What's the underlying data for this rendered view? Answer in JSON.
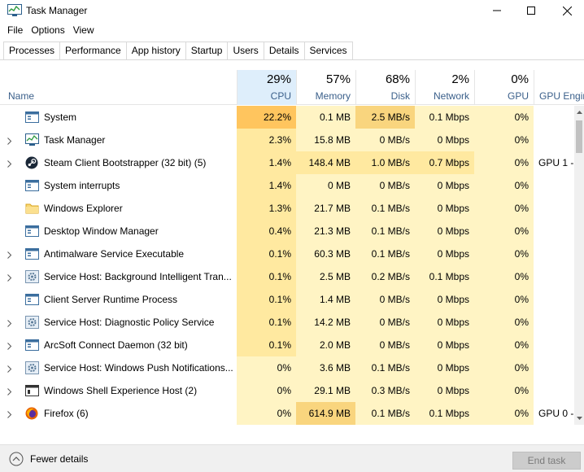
{
  "window": {
    "title": "Task Manager"
  },
  "menu": [
    "File",
    "Options",
    "View"
  ],
  "tabs": [
    {
      "label": "Processes",
      "active": true
    },
    {
      "label": "Performance"
    },
    {
      "label": "App history"
    },
    {
      "label": "Startup"
    },
    {
      "label": "Users"
    },
    {
      "label": "Details"
    },
    {
      "label": "Services"
    }
  ],
  "columns": {
    "name": "Name",
    "cpu": {
      "pct": "29%",
      "label": "CPU"
    },
    "memory": {
      "pct": "57%",
      "label": "Memory"
    },
    "disk": {
      "pct": "68%",
      "label": "Disk"
    },
    "network": {
      "pct": "2%",
      "label": "Network"
    },
    "gpu": {
      "pct": "0%",
      "label": "GPU"
    },
    "gpu_engine": {
      "label": "GPU Engin"
    }
  },
  "colors": {
    "heat_1": "#fff4c4",
    "heat_2": "#ffe9a0",
    "heat_3": "#f9d57e",
    "heat_4": "#ffc55e",
    "header_selected": "#deeefb",
    "header_label": "#3a5f8a"
  },
  "processes": [
    {
      "name": "System",
      "icon": "system-window-icon",
      "expandable": false,
      "cpu": "22.2%",
      "memory": "0.1 MB",
      "disk": "2.5 MB/s",
      "network": "0.1 Mbps",
      "gpu": "0%",
      "gpu_engine": "",
      "heat": {
        "cpu": 4,
        "memory": 1,
        "disk": 3,
        "network": 1,
        "gpu": 1
      }
    },
    {
      "name": "Task Manager",
      "icon": "task-manager-icon",
      "expandable": true,
      "cpu": "2.3%",
      "memory": "15.8 MB",
      "disk": "0 MB/s",
      "network": "0 Mbps",
      "gpu": "0%",
      "gpu_engine": "",
      "heat": {
        "cpu": 2,
        "memory": 1,
        "disk": 1,
        "network": 1,
        "gpu": 1
      }
    },
    {
      "name": "Steam Client Bootstrapper (32 bit) (5)",
      "icon": "steam-icon",
      "expandable": true,
      "cpu": "1.4%",
      "memory": "148.4 MB",
      "disk": "1.0 MB/s",
      "network": "0.7 Mbps",
      "gpu": "0%",
      "gpu_engine": "GPU 1 -",
      "heat": {
        "cpu": 2,
        "memory": 2,
        "disk": 2,
        "network": 2,
        "gpu": 1
      }
    },
    {
      "name": "System interrupts",
      "icon": "system-window-icon",
      "expandable": false,
      "cpu": "1.4%",
      "memory": "0 MB",
      "disk": "0 MB/s",
      "network": "0 Mbps",
      "gpu": "0%",
      "gpu_engine": "",
      "heat": {
        "cpu": 2,
        "memory": 1,
        "disk": 1,
        "network": 1,
        "gpu": 1
      }
    },
    {
      "name": "Windows Explorer",
      "icon": "folder-icon",
      "expandable": false,
      "cpu": "1.3%",
      "memory": "21.7 MB",
      "disk": "0.1 MB/s",
      "network": "0 Mbps",
      "gpu": "0%",
      "gpu_engine": "",
      "heat": {
        "cpu": 2,
        "memory": 1,
        "disk": 1,
        "network": 1,
        "gpu": 1
      }
    },
    {
      "name": "Desktop Window Manager",
      "icon": "system-window-icon",
      "expandable": false,
      "cpu": "0.4%",
      "memory": "21.3 MB",
      "disk": "0.1 MB/s",
      "network": "0 Mbps",
      "gpu": "0%",
      "gpu_engine": "",
      "heat": {
        "cpu": 2,
        "memory": 1,
        "disk": 1,
        "network": 1,
        "gpu": 1
      }
    },
    {
      "name": "Antimalware Service Executable",
      "icon": "system-window-icon",
      "expandable": true,
      "cpu": "0.1%",
      "memory": "60.3 MB",
      "disk": "0.1 MB/s",
      "network": "0 Mbps",
      "gpu": "0%",
      "gpu_engine": "",
      "heat": {
        "cpu": 2,
        "memory": 1,
        "disk": 1,
        "network": 1,
        "gpu": 1
      }
    },
    {
      "name": "Service Host: Background Intelligent Tran...",
      "icon": "gear-icon",
      "expandable": true,
      "cpu": "0.1%",
      "memory": "2.5 MB",
      "disk": "0.2 MB/s",
      "network": "0.1 Mbps",
      "gpu": "0%",
      "gpu_engine": "",
      "heat": {
        "cpu": 2,
        "memory": 1,
        "disk": 1,
        "network": 1,
        "gpu": 1
      }
    },
    {
      "name": "Client Server Runtime Process",
      "icon": "system-window-icon",
      "expandable": false,
      "cpu": "0.1%",
      "memory": "1.4 MB",
      "disk": "0 MB/s",
      "network": "0 Mbps",
      "gpu": "0%",
      "gpu_engine": "",
      "heat": {
        "cpu": 2,
        "memory": 1,
        "disk": 1,
        "network": 1,
        "gpu": 1
      }
    },
    {
      "name": "Service Host: Diagnostic Policy Service",
      "icon": "gear-icon",
      "expandable": true,
      "cpu": "0.1%",
      "memory": "14.2 MB",
      "disk": "0 MB/s",
      "network": "0 Mbps",
      "gpu": "0%",
      "gpu_engine": "",
      "heat": {
        "cpu": 2,
        "memory": 1,
        "disk": 1,
        "network": 1,
        "gpu": 1
      }
    },
    {
      "name": "ArcSoft Connect Daemon (32 bit)",
      "icon": "system-window-icon",
      "expandable": true,
      "cpu": "0.1%",
      "memory": "2.0 MB",
      "disk": "0 MB/s",
      "network": "0 Mbps",
      "gpu": "0%",
      "gpu_engine": "",
      "heat": {
        "cpu": 2,
        "memory": 1,
        "disk": 1,
        "network": 1,
        "gpu": 1
      }
    },
    {
      "name": "Service Host: Windows Push Notifications...",
      "icon": "gear-icon",
      "expandable": true,
      "cpu": "0%",
      "memory": "3.6 MB",
      "disk": "0.1 MB/s",
      "network": "0 Mbps",
      "gpu": "0%",
      "gpu_engine": "",
      "heat": {
        "cpu": 1,
        "memory": 1,
        "disk": 1,
        "network": 1,
        "gpu": 1
      }
    },
    {
      "name": "Windows Shell Experience Host (2)",
      "icon": "shell-window-icon",
      "expandable": true,
      "cpu": "0%",
      "memory": "29.1 MB",
      "disk": "0.3 MB/s",
      "network": "0 Mbps",
      "gpu": "0%",
      "gpu_engine": "",
      "heat": {
        "cpu": 1,
        "memory": 1,
        "disk": 1,
        "network": 1,
        "gpu": 1
      }
    },
    {
      "name": "Firefox (6)",
      "icon": "firefox-icon",
      "expandable": true,
      "cpu": "0%",
      "memory": "614.9 MB",
      "disk": "0.1 MB/s",
      "network": "0.1 Mbps",
      "gpu": "0%",
      "gpu_engine": "GPU 0 -",
      "heat": {
        "cpu": 1,
        "memory": 3,
        "disk": 1,
        "network": 1,
        "gpu": 1
      }
    }
  ],
  "footer": {
    "fewer_details": "Fewer details",
    "end_task": "End task"
  }
}
